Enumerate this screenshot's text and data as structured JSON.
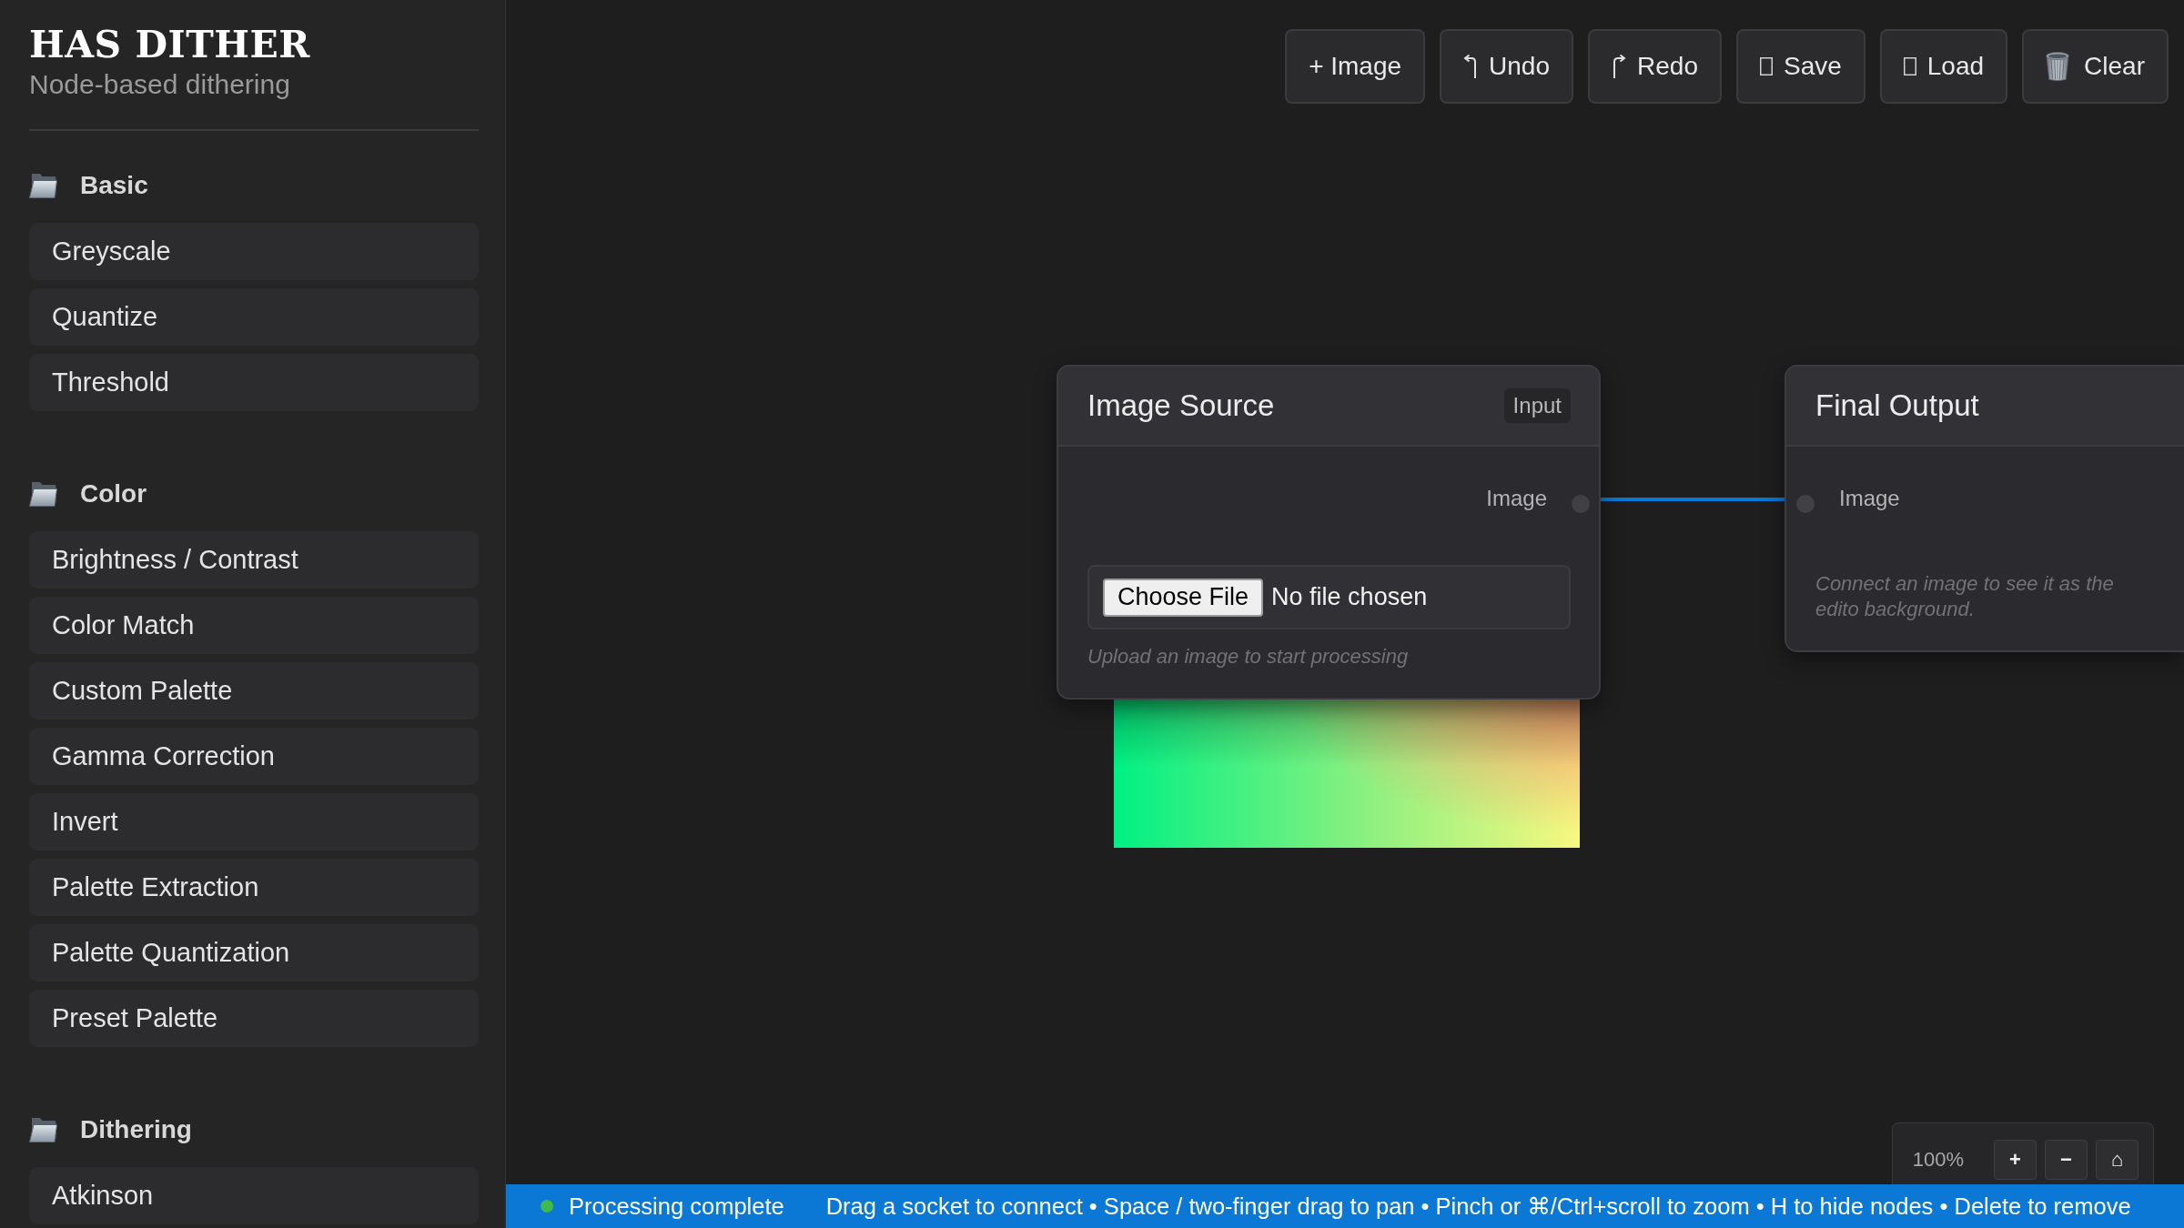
{
  "app": {
    "title": "HAS DITHER",
    "subtitle": "Node-based dithering"
  },
  "sidebar": {
    "sections": [
      {
        "label": "Basic",
        "items": [
          "Greyscale",
          "Quantize",
          "Threshold"
        ]
      },
      {
        "label": "Color",
        "items": [
          "Brightness / Contrast",
          "Color Match",
          "Custom Palette",
          "Gamma Correction",
          "Invert",
          "Palette Extraction",
          "Palette Quantization",
          "Preset Palette"
        ]
      },
      {
        "label": "Dithering",
        "items": [
          "Atkinson"
        ]
      }
    ]
  },
  "toolbar": {
    "buttons": [
      "+ Image",
      "Undo",
      "Redo",
      "Save",
      "Load",
      "Clear"
    ]
  },
  "canvas": {
    "nodes": [
      {
        "title": "Image Source",
        "badge": "Input",
        "socket": {
          "label": "Image",
          "connected": true
        },
        "file_input": {
          "button": "Choose File",
          "value": "No file chosen"
        },
        "hint": "Upload an image to start processing",
        "preview": true
      },
      {
        "title": "Final Output",
        "socket": {
          "label": "Image"
        },
        "hint": "Connect an image to see it as the edito background."
      }
    ]
  },
  "zoom_controls": {
    "zoom": "100%",
    "buttons": [
      "+",
      "−",
      "⌂"
    ]
  },
  "status_bar": {
    "ok": true,
    "status": "Processing complete",
    "help": "Drag a socket to connect • Space / two-finger drag to pan • Pinch or ⌘/Ctrl+scroll to zoom • H to hide nodes • Delete to remove"
  }
}
